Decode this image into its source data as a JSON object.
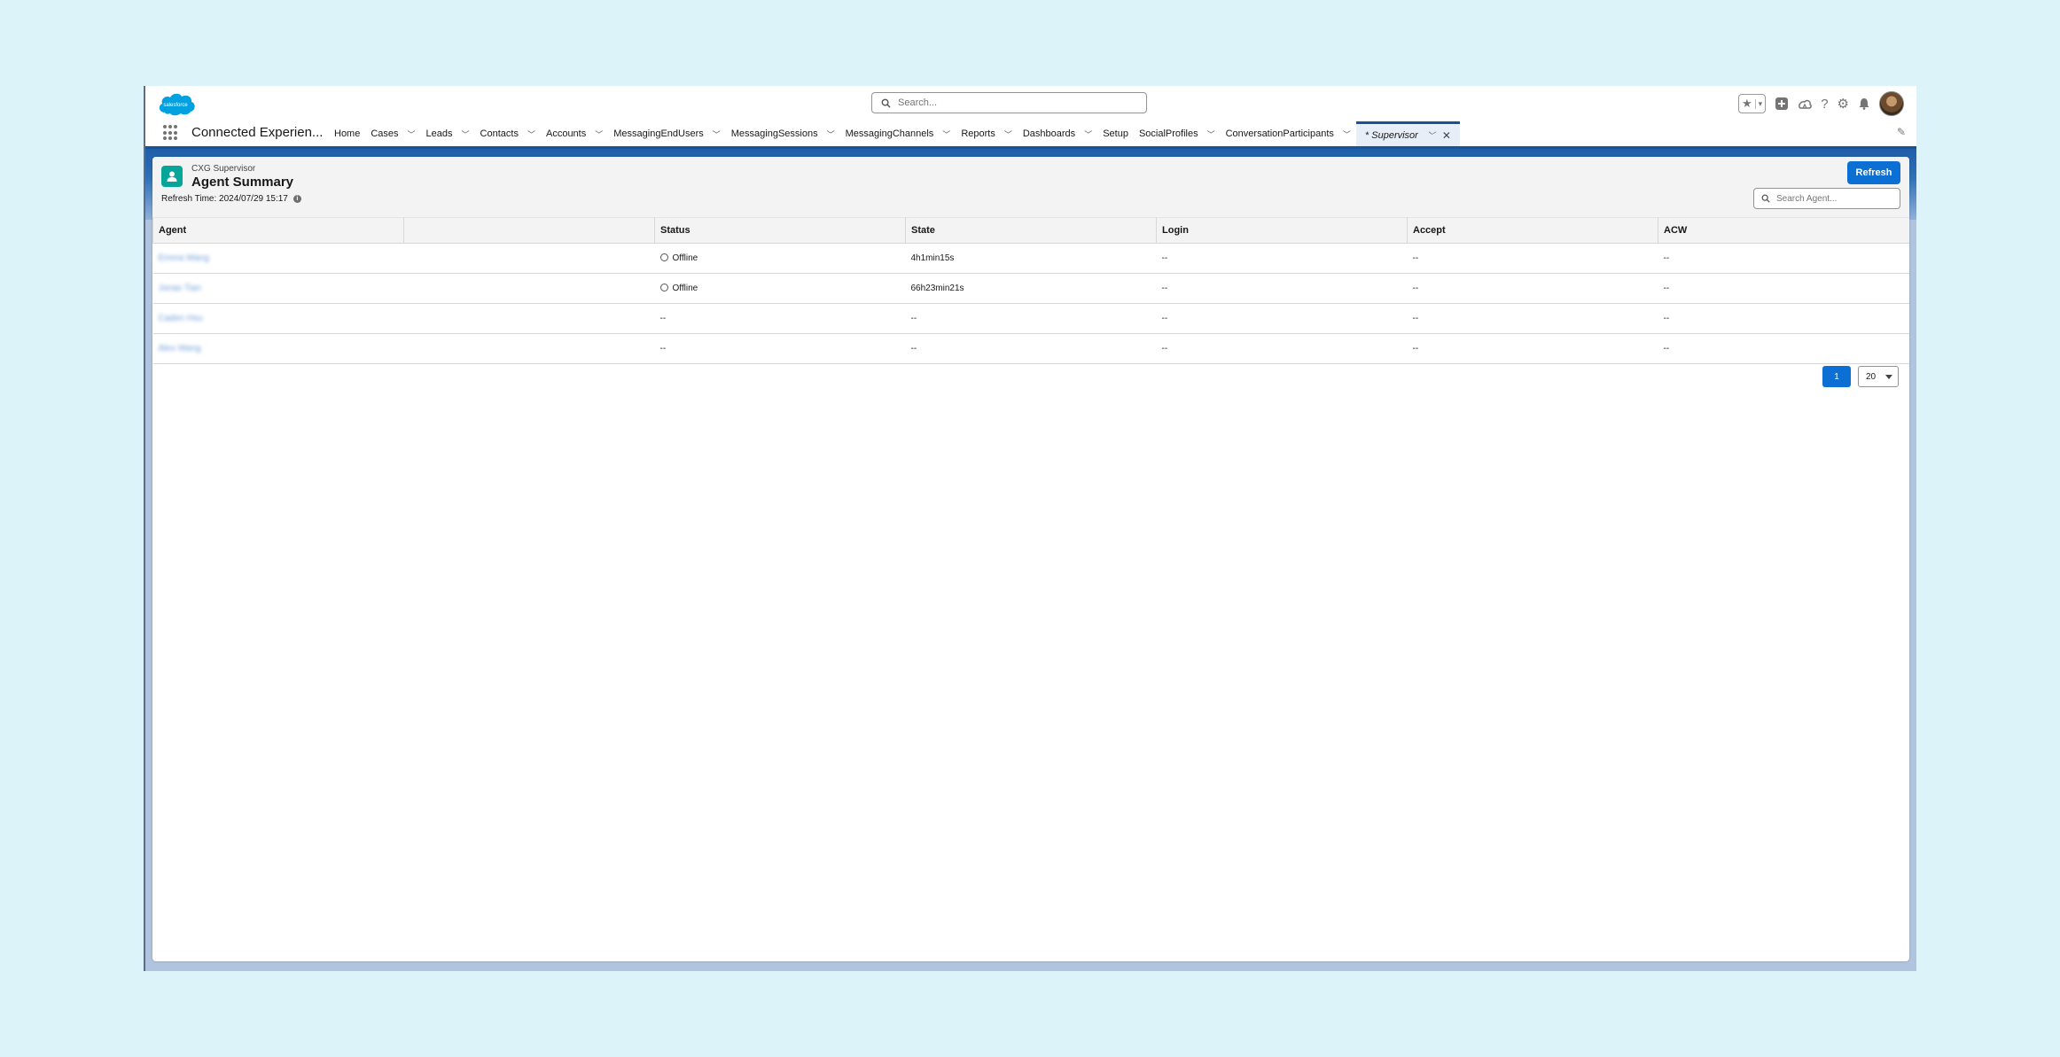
{
  "header": {
    "logo_text": "salesforce",
    "search_placeholder": "Search...",
    "colors": {
      "brand": "#00a1e0",
      "accent": "#0b6fd3"
    }
  },
  "nav": {
    "app_name": "Connected Experien...",
    "items": [
      {
        "label": "Home",
        "dropdown": false
      },
      {
        "label": "Cases",
        "dropdown": true
      },
      {
        "label": "Leads",
        "dropdown": true
      },
      {
        "label": "Contacts",
        "dropdown": true
      },
      {
        "label": "Accounts",
        "dropdown": true
      },
      {
        "label": "MessagingEndUsers",
        "dropdown": true
      },
      {
        "label": "MessagingSessions",
        "dropdown": true
      },
      {
        "label": "MessagingChannels",
        "dropdown": true
      },
      {
        "label": "Reports",
        "dropdown": true
      },
      {
        "label": "Dashboards",
        "dropdown": true
      },
      {
        "label": "Setup",
        "dropdown": false
      },
      {
        "label": "SocialProfiles",
        "dropdown": true
      },
      {
        "label": "ConversationParticipants",
        "dropdown": true
      }
    ],
    "active_tab": "* Supervisor"
  },
  "page": {
    "context": "CXG Supervisor",
    "title": "Agent Summary",
    "refresh_time": "Refresh Time: 2024/07/29 15:17",
    "refresh_button": "Refresh",
    "agent_search_placeholder": "Search Agent..."
  },
  "table": {
    "headers": [
      "Agent",
      "",
      "Status",
      "State",
      "Login",
      "Accept",
      "ACW"
    ],
    "rows": [
      {
        "agent": "Emma Wang",
        "status": "Offline",
        "state": "4h1min15s",
        "login": "--",
        "accept": "--",
        "acw": "--"
      },
      {
        "agent": "Jonas Tian",
        "status": "Offline",
        "state": "66h23min21s",
        "login": "--",
        "accept": "--",
        "acw": "--"
      },
      {
        "agent": "Caden Hsu",
        "status": "--",
        "state": "--",
        "login": "--",
        "accept": "--",
        "acw": "--"
      },
      {
        "agent": "Alex Wang",
        "status": "--",
        "state": "--",
        "login": "--",
        "accept": "--",
        "acw": "--"
      }
    ]
  },
  "pagination": {
    "current_page": "1",
    "page_size": "20"
  }
}
